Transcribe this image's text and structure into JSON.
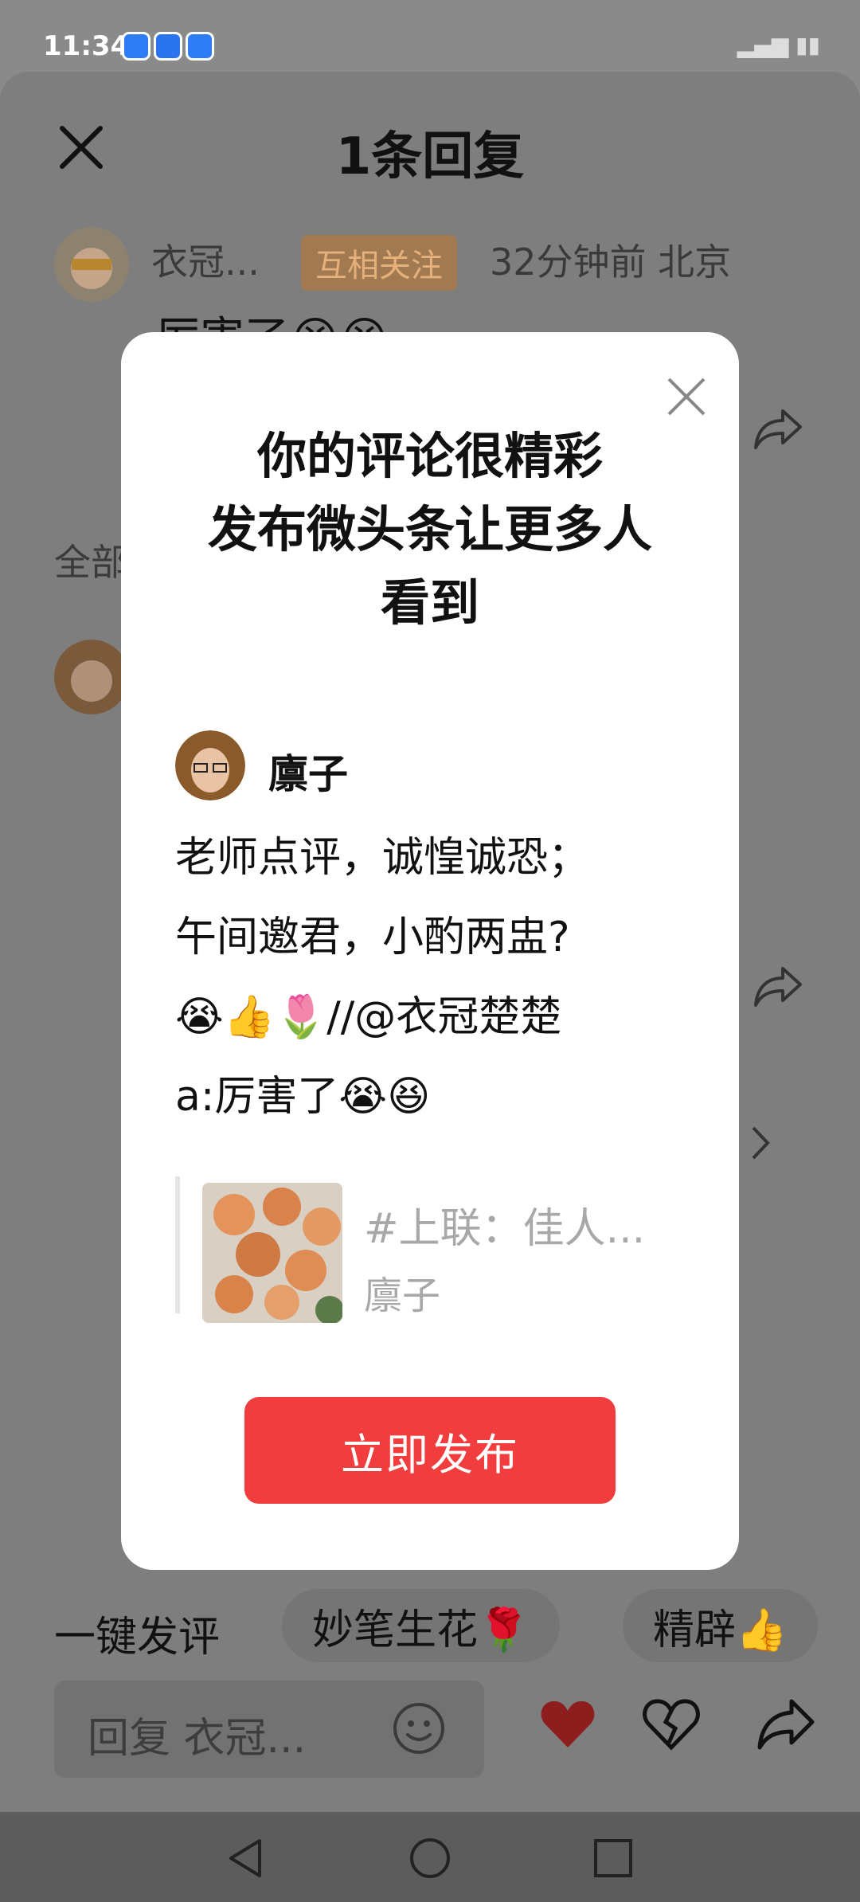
{
  "status_bar": {
    "time": "11:34"
  },
  "header": {
    "title": "1条回复"
  },
  "background_comment": {
    "username": "衣冠...",
    "follow_badge": "互相关注",
    "meta": "32分钟前  北京",
    "text": "厉害了😭😆",
    "section_label": "全部"
  },
  "modal": {
    "title_lines": [
      "你的评论很精彩",
      "发布微头条让更多人",
      "看到"
    ],
    "author_name": "廪子",
    "comment_lines": [
      "老师点评，诚惶诚恐；",
      "午间邀君，小酌两盅?",
      "😭👍🌷//@衣冠楚楚",
      "a:厉害了😭😆"
    ],
    "quote": {
      "title": "#上联：佳人...",
      "author": "廪子"
    },
    "publish_button": "立即发布"
  },
  "quick_replies": {
    "label": "一键发评",
    "chips": [
      "妙笔生花🌹",
      "精辟👍"
    ]
  },
  "reply_bar": {
    "placeholder": "回复 衣冠..."
  },
  "colors": {
    "accent": "#f13d3d",
    "overlay": "#8a8a8a",
    "follow": "#e6b07b"
  }
}
